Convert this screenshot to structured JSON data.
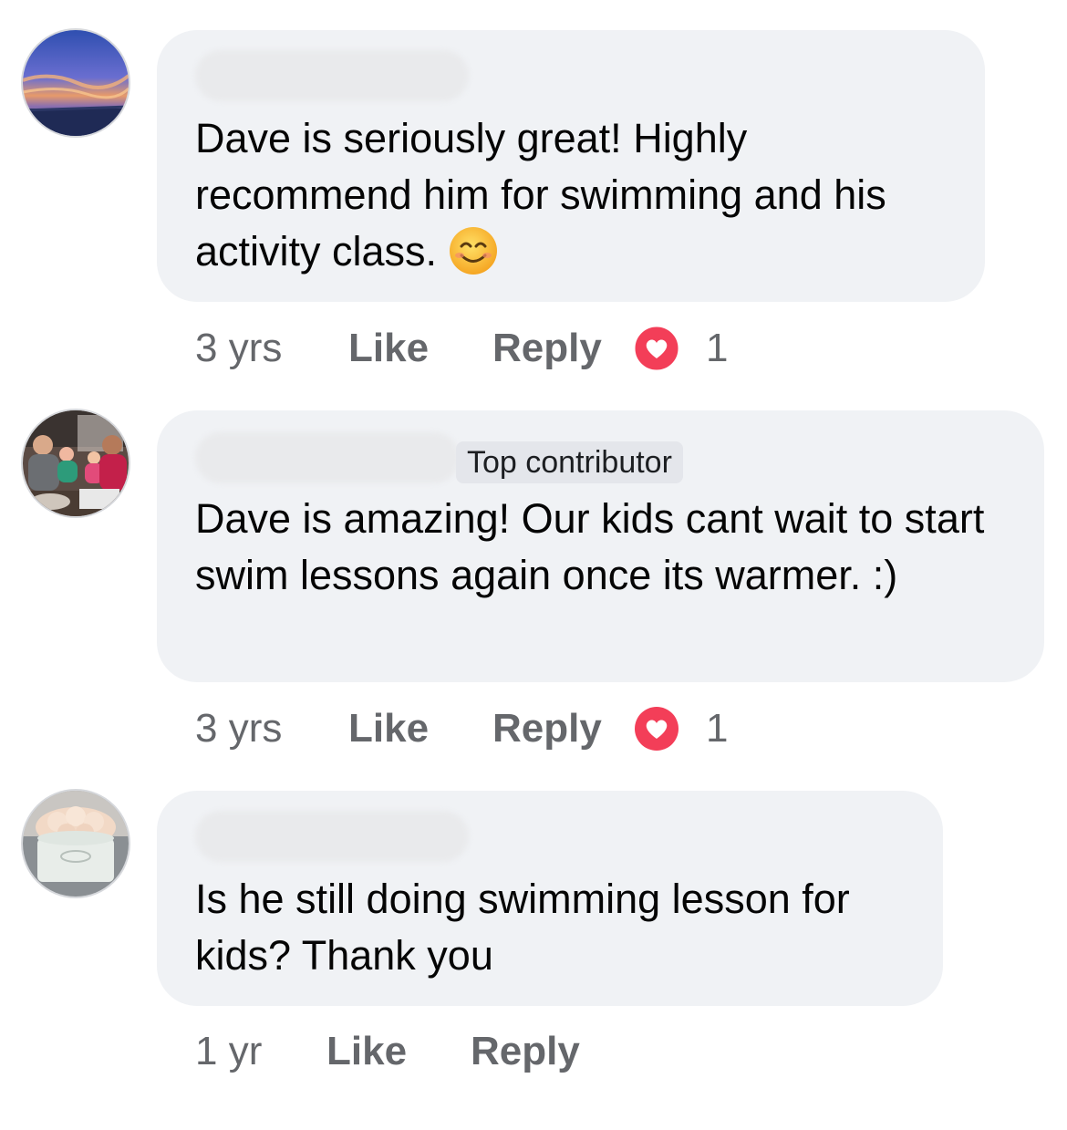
{
  "comments": [
    {
      "text": "Dave is seriously great! Highly recommend him for swimming and his activity class.",
      "emoji": "smiling-face-emoji",
      "time": "3 yrs",
      "like": "Like",
      "reply": "Reply",
      "reaction": {
        "icon": "heart-icon",
        "count": "1"
      }
    },
    {
      "badge": "Top contributor",
      "text": "Dave is amazing! Our kids cant wait to start swim lessons again once its warmer. :)",
      "time": "3 yrs",
      "like": "Like",
      "reply": "Reply",
      "reaction": {
        "icon": "heart-icon",
        "count": "1"
      }
    },
    {
      "text": "Is he still doing swimming lesson for kids? Thank you",
      "time": "1 yr",
      "like": "Like",
      "reply": "Reply"
    }
  ],
  "colors": {
    "bubble": "#f0f2f5",
    "meta_text": "#65676b",
    "heart": "#f33e58"
  }
}
